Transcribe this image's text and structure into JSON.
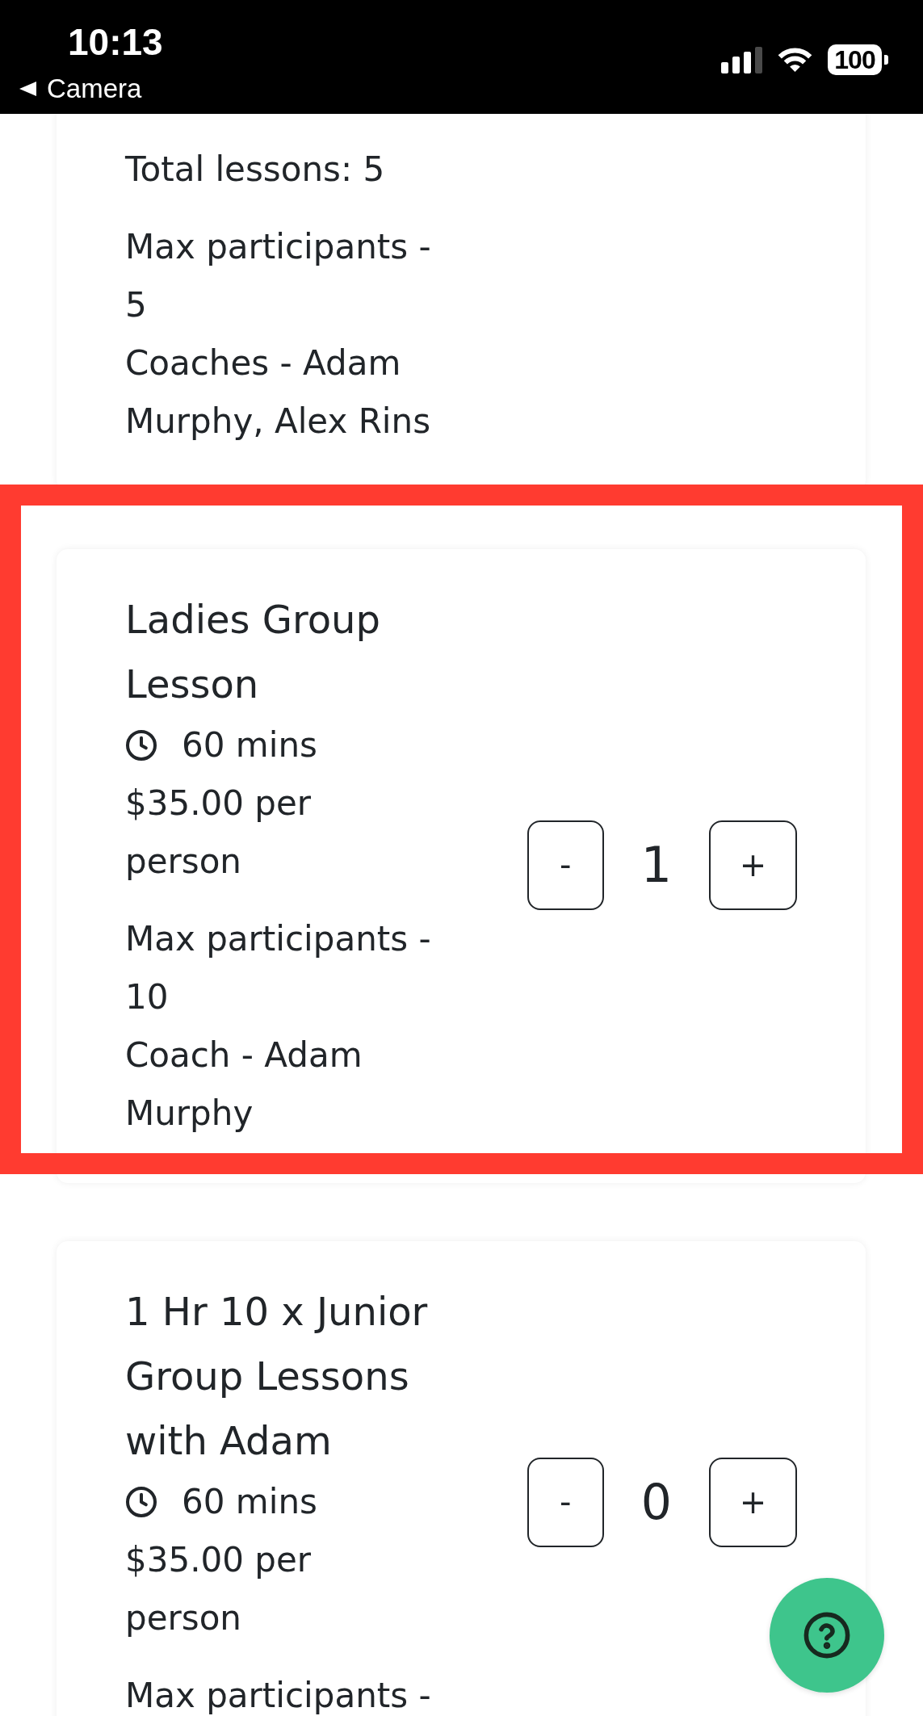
{
  "status_bar": {
    "time": "10:13",
    "back_label": "Camera",
    "battery": "100"
  },
  "lessons": [
    {
      "highlighted": false,
      "total_lessons": "Total lessons: 5",
      "max_participants": "Max participants - 5",
      "coaches": "Coaches - Adam Murphy, Alex Rins"
    },
    {
      "highlighted": true,
      "title": "Ladies Group Lesson",
      "duration": "60 mins",
      "price": "$35.00 per person",
      "max_participants": "Max participants - 10",
      "coaches": "Coach - Adam Murphy",
      "stepper": {
        "minus": "-",
        "quantity": "1",
        "plus": "+"
      }
    },
    {
      "highlighted": false,
      "title": "1 Hr 10 x Junior Group Lessons with Adam",
      "duration": "60 mins",
      "price": "$35.00 per person",
      "max_participants": "Max participants -",
      "stepper": {
        "minus": "-",
        "quantity": "0",
        "plus": "+"
      }
    }
  ]
}
